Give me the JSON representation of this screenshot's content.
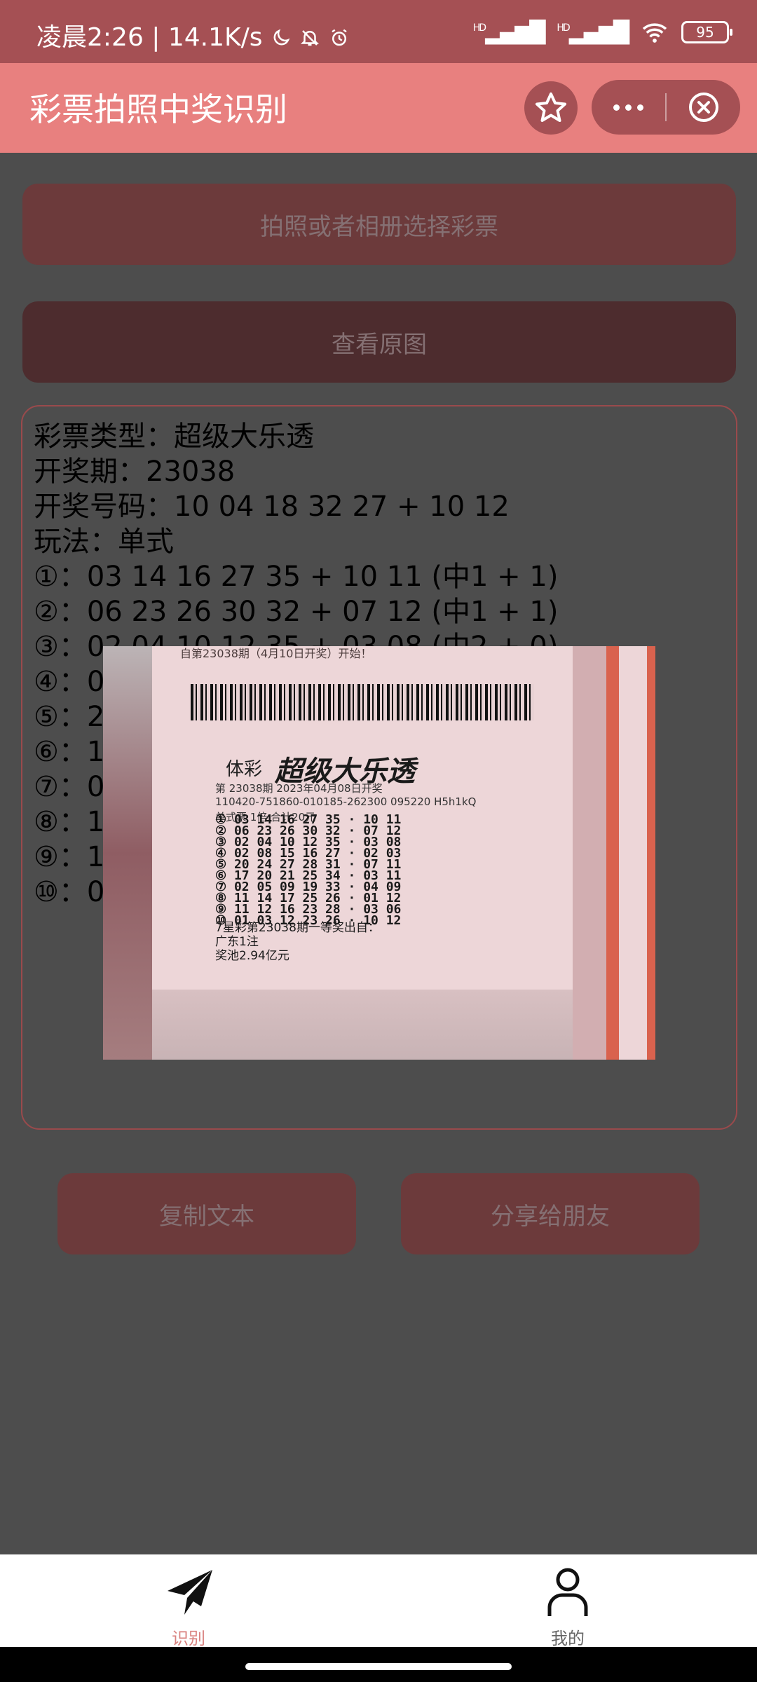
{
  "status_bar": {
    "time": "凌晨2:26",
    "net_speed": "14.1K/s",
    "signal_1": "HD",
    "signal_2": "HD",
    "battery": "95"
  },
  "header": {
    "title": "彩票拍照中奖识别"
  },
  "buttons": {
    "photo": "拍照或者相册选择彩票",
    "view_original": "查看原图",
    "copy": "复制文本",
    "share": "分享给朋友"
  },
  "result": {
    "lines": [
      "彩票类型：超级大乐透",
      "开奖期：23038",
      "开奖号码：10 04 18 32 27 + 10 12",
      "玩法：单式",
      "①：03 14 16 27 35 + 10 11 (中1 + 1)",
      "②：06 23 26 30 32 + 07 12 (中1 + 1)",
      "③：02 04 10 12 35 + 03 08 (中2 + 0)",
      "④：0",
      "⑤：2",
      "⑥：1",
      "⑦：0",
      "⑧：1",
      "⑨：1",
      "⑩：0"
    ]
  },
  "ticket_photo": {
    "header": "自第23038期（4月10日开奖）开始！",
    "brand": "体彩",
    "title": "超级大乐透",
    "issue": "第 23038期   2023年04月08日开奖",
    "serial": "110420-751860-010185-262300 095220  H5h1kQ",
    "mode": "单式票          1倍              合计20元",
    "rows": [
      "① 03 14 16 27 35 · 10 11",
      "② 06 23 26 30 32 · 07 12",
      "③ 02 04 10 12 35 · 03 08",
      "④ 02 08 15 16 27 · 02 03",
      "⑤ 20 24 27 28 31 · 07 11",
      "⑥ 17 20 21 25 34 · 03 11",
      "⑦ 02 05 09 19 33 · 04 09",
      "⑧ 11 14 17 25 26 · 01 12",
      "⑨ 11 12 16 23 28 · 03 06",
      "⑩ 01 03 12 23 26 · 10 12"
    ],
    "footer": [
      "7星彩第23038期一等奖出自：",
      "广东1注",
      "奖池2.94亿元"
    ]
  },
  "tabbar": {
    "recognize": "识别",
    "mine": "我的"
  },
  "colors": {
    "accent": "#e8807f",
    "status_bar": "#a55054",
    "button": "#6c3a3b"
  }
}
